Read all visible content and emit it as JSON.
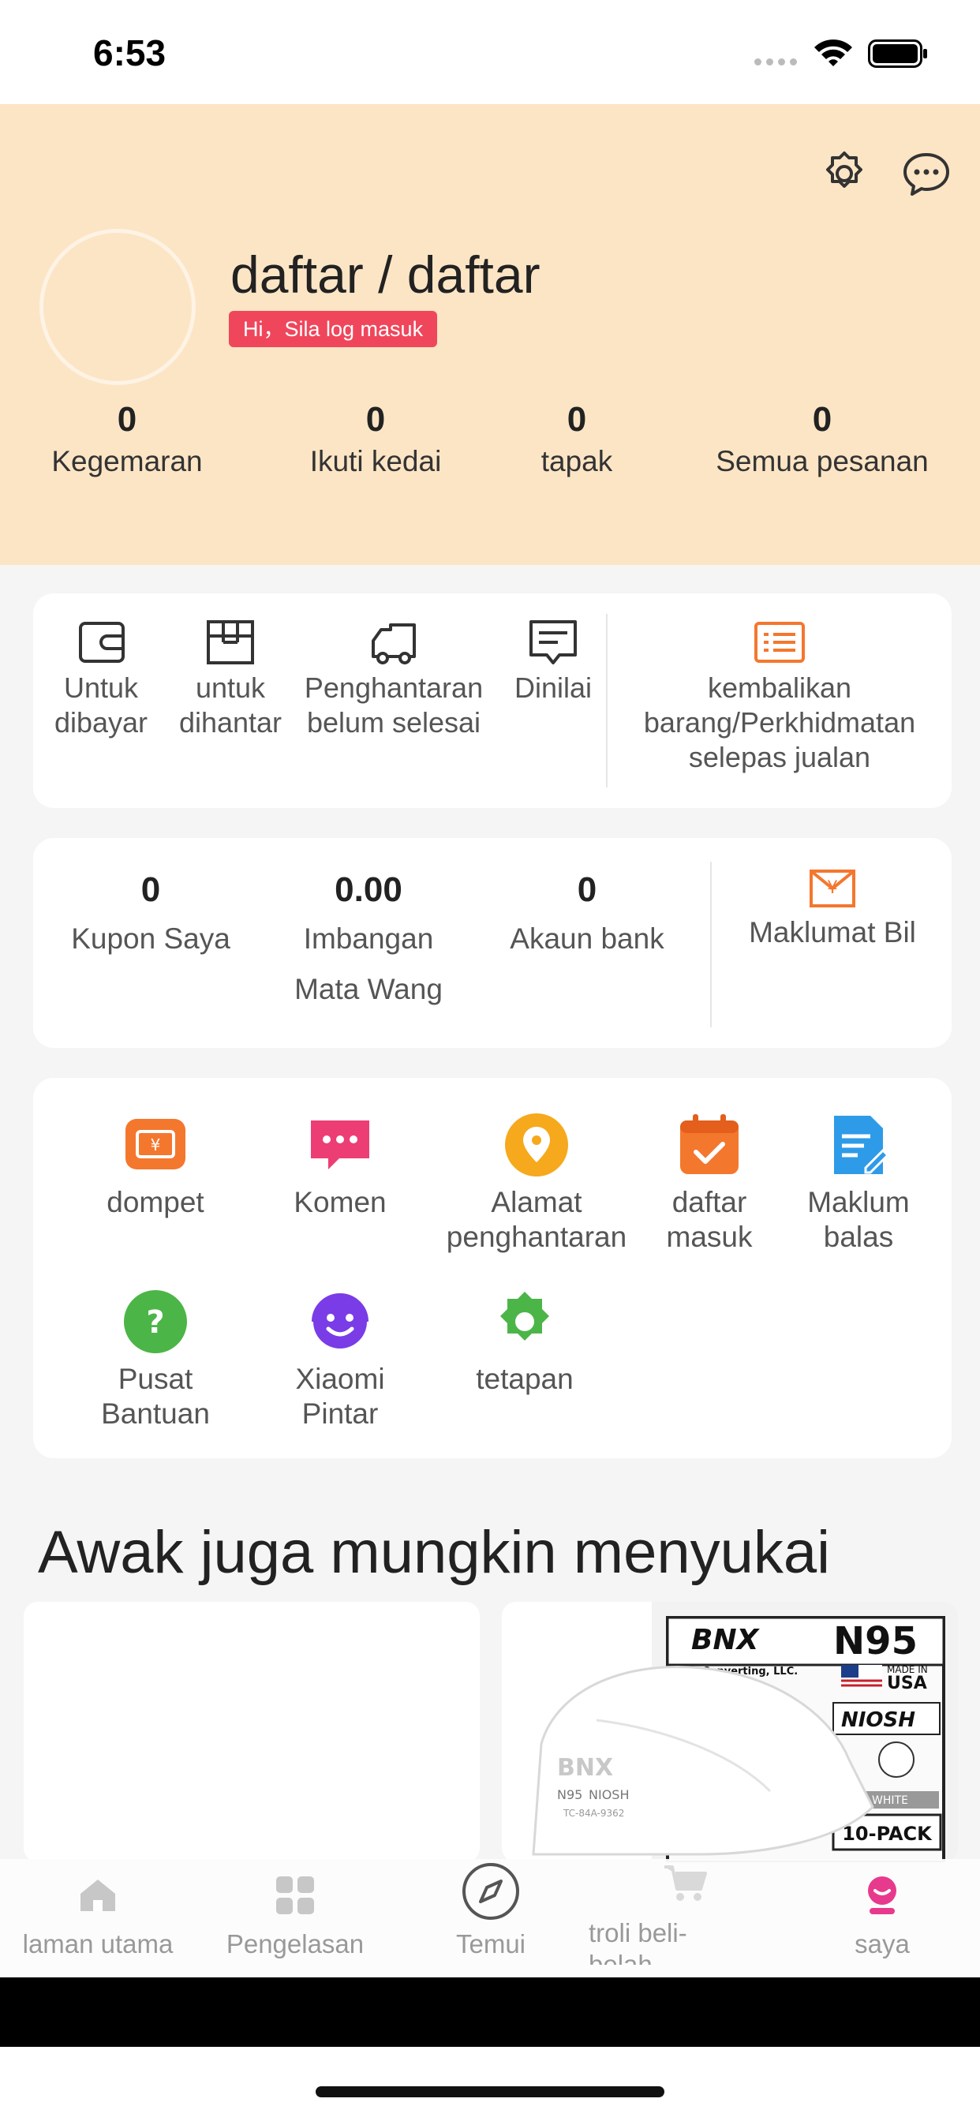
{
  "status_bar": {
    "time": "6:53"
  },
  "profile": {
    "title": "daftar / daftar",
    "badge": "Hi，Sila log masuk"
  },
  "stats": [
    {
      "value": "0",
      "label": "Kegemaran"
    },
    {
      "value": "0",
      "label": "Ikuti kedai"
    },
    {
      "value": "0",
      "label": "tapak"
    },
    {
      "value": "0",
      "label": "Semua pesanan"
    }
  ],
  "orders": {
    "to_pay": [
      "Untuk",
      "dibayar"
    ],
    "to_ship": [
      "untuk",
      "dihantar"
    ],
    "shipping": [
      "Penghantaran",
      "belum selesai"
    ],
    "rated": [
      "Dinilai"
    ],
    "refund": [
      "kembalikan",
      "barang/Perkhidmatan",
      "selepas jualan"
    ]
  },
  "assets": {
    "coupons": {
      "value": "0",
      "label": "Kupon Saya"
    },
    "balance": {
      "value": "0.00",
      "label1": "Imbangan",
      "label2": "Mata Wang"
    },
    "bank": {
      "value": "0",
      "label": "Akaun bank"
    },
    "bill": {
      "label": "Maklumat Bil"
    }
  },
  "services": [
    {
      "label1": "dompet",
      "label2": "",
      "icon": "wallet-icon",
      "color": "#f4772e"
    },
    {
      "label1": "Komen",
      "label2": "",
      "icon": "comment-icon",
      "color": "#ec3e74"
    },
    {
      "label1": "Alamat",
      "label2": "penghantaran",
      "icon": "location-icon",
      "color": "#f6a91c"
    },
    {
      "label1": "daftar",
      "label2": "masuk",
      "icon": "calendar-icon",
      "color": "#f4772e"
    },
    {
      "label1": "Maklum",
      "label2": "balas",
      "icon": "feedback-icon",
      "color": "#2e9be8"
    },
    {
      "label1": "Pusat",
      "label2": "Bantuan",
      "icon": "help-icon",
      "color": "#4cb548"
    },
    {
      "label1": "Xiaomi",
      "label2": "Pintar",
      "icon": "assistant-icon",
      "color": "#7a3ce6"
    },
    {
      "label1": "tetapan",
      "label2": "",
      "icon": "settings-icon",
      "color": "#4cb548"
    }
  ],
  "recommend": {
    "title": "Awak juga mungkin menyukai",
    "product": {
      "brand": "BNX",
      "badge": "N95",
      "made_in": "MADE IN",
      "country": "USA",
      "company": "Converting, LLC.",
      "niosh": "NIOSH",
      "white": "WHITE",
      "pack": "10-PACK",
      "model": "N95",
      "code": "TC-84A-9362"
    }
  },
  "tabbar": [
    {
      "label": "laman utama",
      "icon": "home-icon"
    },
    {
      "label": "Pengelasan",
      "icon": "grid-icon"
    },
    {
      "label": "Temui",
      "icon": "compass-icon"
    },
    {
      "label": "troli beli-belah",
      "icon": "cart-icon"
    },
    {
      "label": "saya",
      "icon": "profile-icon"
    }
  ],
  "colors": {
    "header_bg": "#fce5c5",
    "badge": "#f0465b",
    "accent": "#f4772e",
    "active_tab": "#e83a8c"
  }
}
